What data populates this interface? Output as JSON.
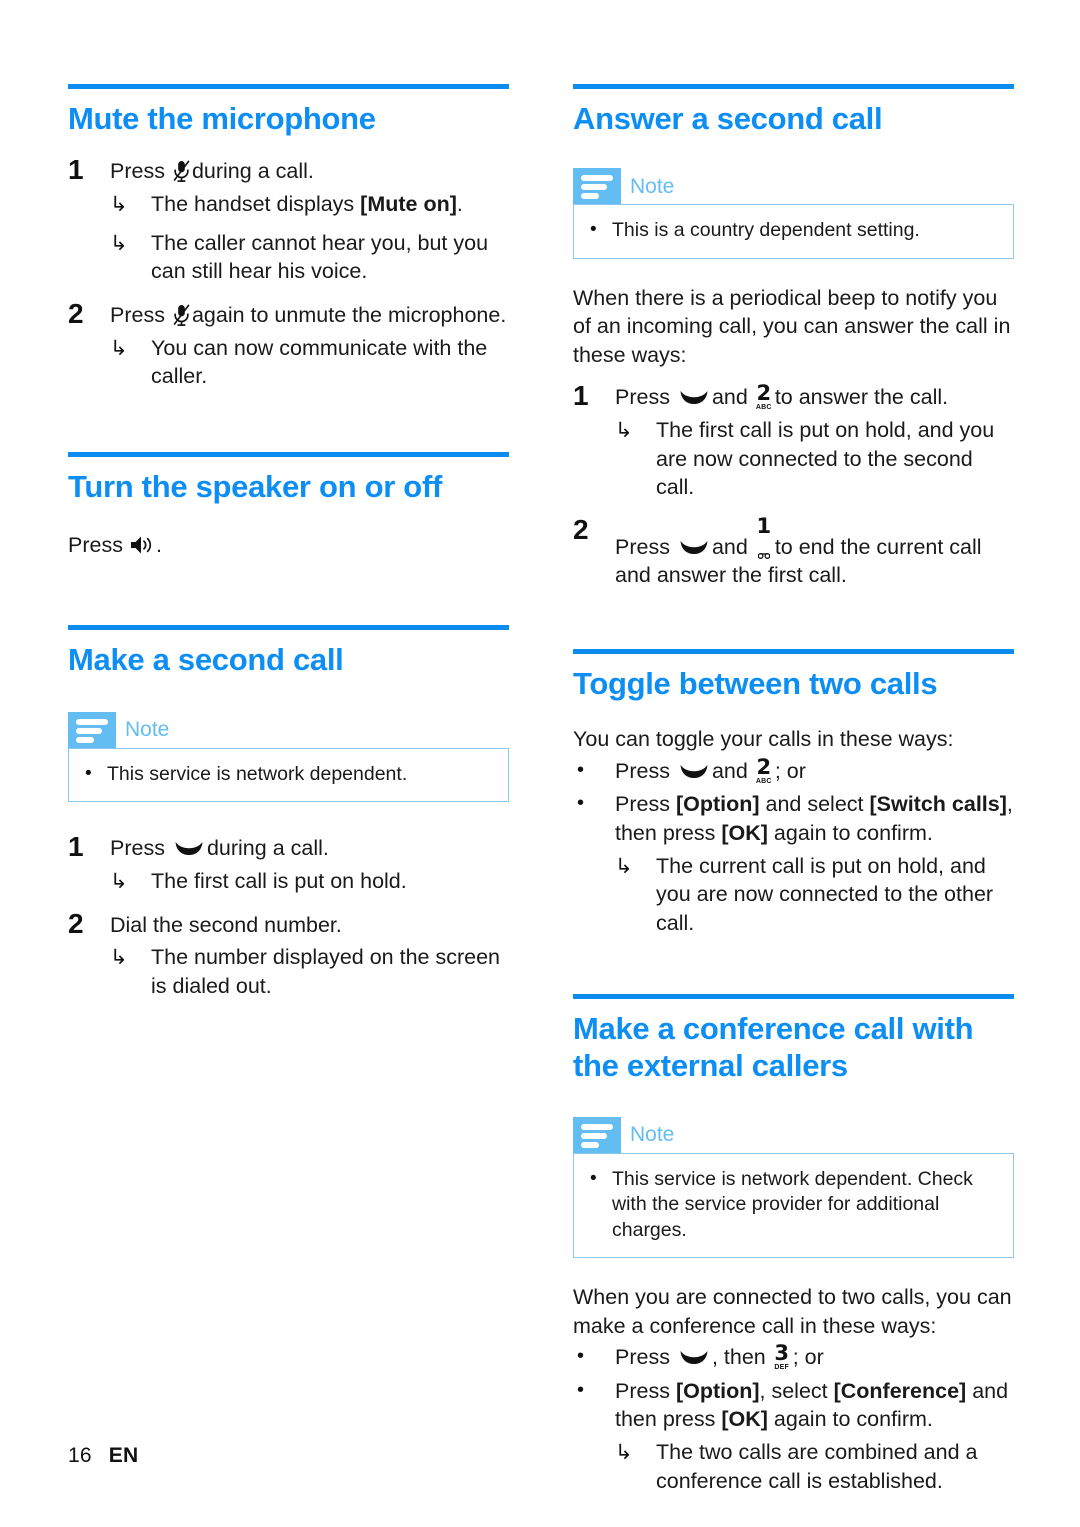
{
  "colors": {
    "heading_blue": "#0d8ef5",
    "rule_blue": "#0a8cf0",
    "note_icon_blue": "#63bdf2",
    "note_border_blue": "#8cc9ef",
    "body_text": "#1a1a1a"
  },
  "footer": {
    "page_number": "16",
    "language": "EN"
  },
  "left_column": {
    "sections": [
      {
        "heading": "Mute the microphone",
        "steps": [
          {
            "number": "1",
            "text_before": "Press",
            "icon": "mute-microphone-icon",
            "text_after": "during a call.",
            "results": [
              {
                "pre": "The handset displays ",
                "bold": "[Mute on]",
                "post": "."
              },
              {
                "pre": "The caller cannot hear you, but you can still hear his voice.",
                "bold": "",
                "post": ""
              }
            ]
          },
          {
            "number": "2",
            "text_before": "Press",
            "icon": "mute-microphone-icon",
            "text_after": "again to unmute the microphone.",
            "results": [
              {
                "pre": "You can now communicate with the caller.",
                "bold": "",
                "post": ""
              }
            ]
          }
        ]
      },
      {
        "heading": "Turn the speaker on or off",
        "press_line_before": "Press",
        "press_line_icon": "speaker-icon",
        "press_line_after": "."
      },
      {
        "heading": "Make a second call",
        "note": {
          "label": "Note",
          "items": [
            "This service is network dependent."
          ]
        },
        "steps": [
          {
            "number": "1",
            "text_before": "Press",
            "icon": "call-key-icon",
            "text_after": "during a call.",
            "results": [
              {
                "pre": "The first call is put on hold.",
                "bold": "",
                "post": ""
              }
            ]
          },
          {
            "number": "2",
            "text_before": "Dial the second number.",
            "icon": "",
            "text_after": "",
            "results": [
              {
                "pre": "The number displayed on the screen is dialed out.",
                "bold": "",
                "post": ""
              }
            ]
          }
        ]
      }
    ]
  },
  "right_column": {
    "sections": [
      {
        "heading": "Answer a second call",
        "note": {
          "label": "Note",
          "items": [
            "This is a country dependent setting."
          ]
        },
        "intro": "When there is a periodical beep to notify you of an incoming call, you can answer the call in these ways:",
        "steps": [
          {
            "number": "1",
            "text_before": "Press",
            "icon": "call-key-icon",
            "text_mid": "and",
            "key": {
              "digit": "2",
              "letters": "ABC"
            },
            "text_after": "to answer the call.",
            "results": [
              {
                "pre": "The first call is put on hold, and you are now connected to the second call.",
                "bold": "",
                "post": ""
              }
            ]
          },
          {
            "number": "2",
            "text_before": "Press",
            "icon": "call-key-icon",
            "text_mid": "and",
            "key": {
              "digit": "1",
              "letters": "voicemail"
            },
            "text_after": "to end the current call and answer the first call.",
            "results": []
          }
        ]
      },
      {
        "heading": "Toggle between two calls",
        "intro": "You can toggle your calls in these ways:",
        "bullets": [
          {
            "type": "key_line",
            "text_before": "Press",
            "icon": "call-key-icon",
            "text_mid": "and",
            "key": {
              "digit": "2",
              "letters": "ABC"
            },
            "text_after": "; or"
          },
          {
            "type": "rich",
            "segments": [
              {
                "t": "Press ",
                "b": false
              },
              {
                "t": "[Option]",
                "b": true
              },
              {
                "t": " and select ",
                "b": false
              },
              {
                "t": "[Switch calls]",
                "b": true
              },
              {
                "t": ", then press ",
                "b": false
              },
              {
                "t": "[OK]",
                "b": true
              },
              {
                "t": " again to confirm.",
                "b": false
              }
            ],
            "results": [
              {
                "pre": "The current call is put on hold, and you are now connected to the other call.",
                "bold": "",
                "post": ""
              }
            ]
          }
        ]
      },
      {
        "heading": "Make a conference call with the external callers",
        "note": {
          "label": "Note",
          "items": [
            "This service is network dependent. Check with the service provider for additional charges."
          ]
        },
        "intro": "When you are connected to two calls, you can make a conference call in these ways:",
        "bullets": [
          {
            "type": "key_line",
            "text_before": "Press",
            "icon": "call-key-icon",
            "text_mid": ", then",
            "key": {
              "digit": "3",
              "letters": "DEF"
            },
            "text_after": "; or"
          },
          {
            "type": "rich",
            "segments": [
              {
                "t": "Press ",
                "b": false
              },
              {
                "t": "[Option]",
                "b": true
              },
              {
                "t": ", select ",
                "b": false
              },
              {
                "t": "[Conference]",
                "b": true
              },
              {
                "t": " and then press ",
                "b": false
              },
              {
                "t": "[OK]",
                "b": true
              },
              {
                "t": " again to confirm.",
                "b": false
              }
            ],
            "results": [
              {
                "pre": "The two calls are combined and a conference call is established.",
                "bold": "",
                "post": ""
              }
            ]
          }
        ]
      }
    ]
  },
  "glyphs": {
    "result_arrow": "↳",
    "bullet_dot": "•"
  }
}
